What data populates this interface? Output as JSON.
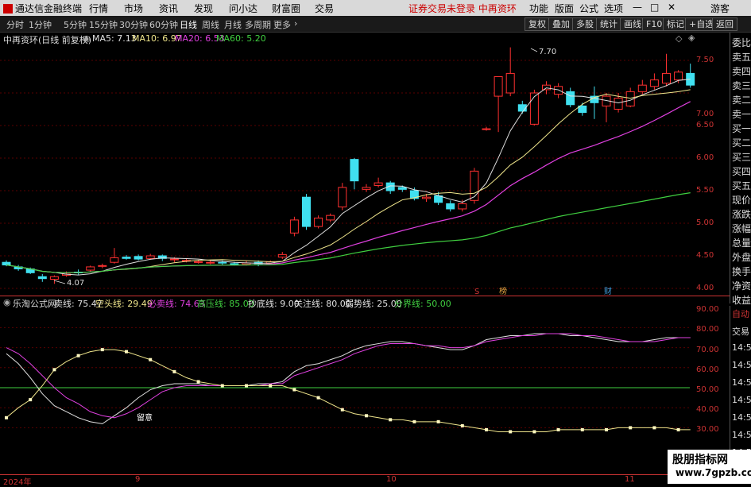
{
  "menu": {
    "app_name": "通达信金融终端",
    "items": [
      "行情",
      "市场",
      "资讯",
      "发现",
      "问小达",
      "财富圈",
      "交易"
    ],
    "status_red": "证券交易未登录 中再资环",
    "right_items": [
      "功能",
      "版面",
      "公式",
      "选项"
    ],
    "guest": "游客",
    "window_controls": [
      "—",
      "□",
      "✕"
    ]
  },
  "periods": [
    "分时",
    "1分钟",
    "5分钟",
    "15分钟",
    "30分钟",
    "60分钟",
    "日线",
    "周线",
    "月线",
    "多周期",
    "更多"
  ],
  "active_period": "日线",
  "toolbar": [
    "复权",
    "叠加",
    "多股",
    "统计",
    "画线",
    "F10",
    "标记",
    "+自选",
    "返回"
  ],
  "main_chart": {
    "title": "中再资环(日线 前复权)",
    "ma_labels": [
      {
        "text": "MA5: 7.13",
        "color": "#e0e0e0"
      },
      {
        "text": "MA10: 6.97",
        "color": "#f0e68c"
      },
      {
        "text": "MA20: 6.53",
        "color": "#e040e0"
      },
      {
        "text": "MA60: 5.20",
        "color": "#40d040"
      }
    ],
    "y_ticks": [
      "7.50",
      "7.00",
      "6.50",
      "6.00",
      "5.50",
      "5.00",
      "4.50",
      "4.00"
    ],
    "high_label": "7.70",
    "low_label": "4.07",
    "markers": [
      "S",
      "榜",
      "财"
    ]
  },
  "right_panel": [
    "委比",
    "卖五",
    "卖四",
    "卖三",
    "卖二",
    "卖一",
    "买一",
    "买二",
    "买三",
    "买四",
    "买五",
    "现价",
    "涨跌",
    "涨幅",
    "总量",
    "外盘",
    "换手",
    "净资",
    "收益"
  ],
  "sub_chart": {
    "title": "乐淘公式网",
    "labels": [
      {
        "text": "卖线: 75.47",
        "color": "#e0e0e0"
      },
      {
        "text": "空头线: 29.49",
        "color": "#f0e68c"
      },
      {
        "text": "必卖线: 74.63",
        "color": "#e040e0"
      },
      {
        "text": "高压线: 85.00",
        "color": "#40d040"
      },
      {
        "text": "抄底线: 9.00",
        "color": "#e0e0e0"
      },
      {
        "text": "关注线: 80.00",
        "color": "#e0e0e0"
      },
      {
        "text": "弱势线: 25.00",
        "color": "#e0e0e0"
      },
      {
        "text": "分界线: 50.00",
        "color": "#40d040"
      }
    ],
    "y_ticks": [
      "90.00",
      "80.00",
      "70.00",
      "60.00",
      "50.00",
      "40.00",
      "30.00"
    ],
    "annotation": "留意"
  },
  "right_panel2": [
    "自动",
    "交易",
    "14:56",
    "14:56",
    "14:56",
    "14:56",
    "14:56",
    "14:56",
    "14:56",
    "14:56"
  ],
  "x_axis": [
    "2024年",
    "9",
    "10",
    "11"
  ],
  "watermark": {
    "line1": "股朋指标网",
    "line2": "www.7gpzb.com"
  }
}
